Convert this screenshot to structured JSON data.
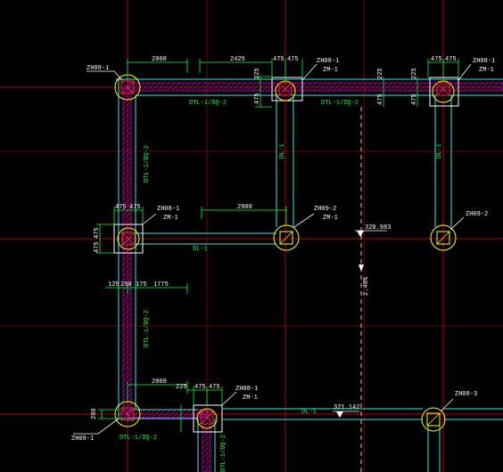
{
  "colors": {
    "background": "#000000",
    "axis_red": "#b40000",
    "axis_dark": "#7a0000",
    "beam_cyan": "#37e6e6",
    "wall_magenta": "#c800c8",
    "column_yellow": "#ffff00",
    "label_green": "#00ff3c",
    "text_white": "#ffffff",
    "hidden_grey": "#c8c8c8"
  },
  "labels": {
    "zh08_1_a": "ZH08-1",
    "zh08_1_b": "ZH08-1",
    "zh08_1_c": "ZH08-1",
    "zh08_1_d": "ZH08-1",
    "zh08_1_e": "ZH08-1",
    "zh08_1_f": "ZH08-1",
    "zh09_2_a": "ZH09-2",
    "zh09_2_b": "ZH09-2",
    "zh08_3": "ZH08-3",
    "zm1_a": "ZM-1",
    "zm1_b": "ZM-1",
    "zm1_c": "ZM-1",
    "zm1_d": "ZM-1",
    "zm1_e": "ZM-1",
    "dtl_top_1": "DTL-1/DQ-2",
    "dtl_top_2": "DTL-1/DQ-2",
    "dtl_left_1": "DTL-1/DQ-2",
    "dtl_left_2": "DTL-1/DQ-2",
    "dtl_bottom": "DTL-1/DQ-2",
    "dtl_bottom_v": "DTL-1/DQ-2",
    "dl1_v_a": "DL-1",
    "dl1_v_b": "DL-1",
    "dl1_h_a": "DL-1",
    "dl1_h_b": "DL-1",
    "elev_1": "320.983",
    "elev_2": "321.142",
    "slope": "2.40%"
  },
  "dims": {
    "d2000_a": "2000",
    "d2425": "2425",
    "d475_a": "475",
    "d475_b": "475",
    "d225_a": "225",
    "d475_c": "475",
    "d225_b": "225",
    "d475_d": "475",
    "d475_e": "475",
    "d475_f": "475",
    "d225_c": "225",
    "d475_g": "475",
    "d475_h": "475",
    "d475_i": "475",
    "d475_j": "475",
    "d2900": "2900",
    "d125": "125",
    "d250": "250",
    "d175": "175",
    "d1775": "1775",
    "d2000_b": "2000",
    "d225_d": "225",
    "d475_k": "475",
    "d475_l": "475",
    "d200": "200"
  }
}
